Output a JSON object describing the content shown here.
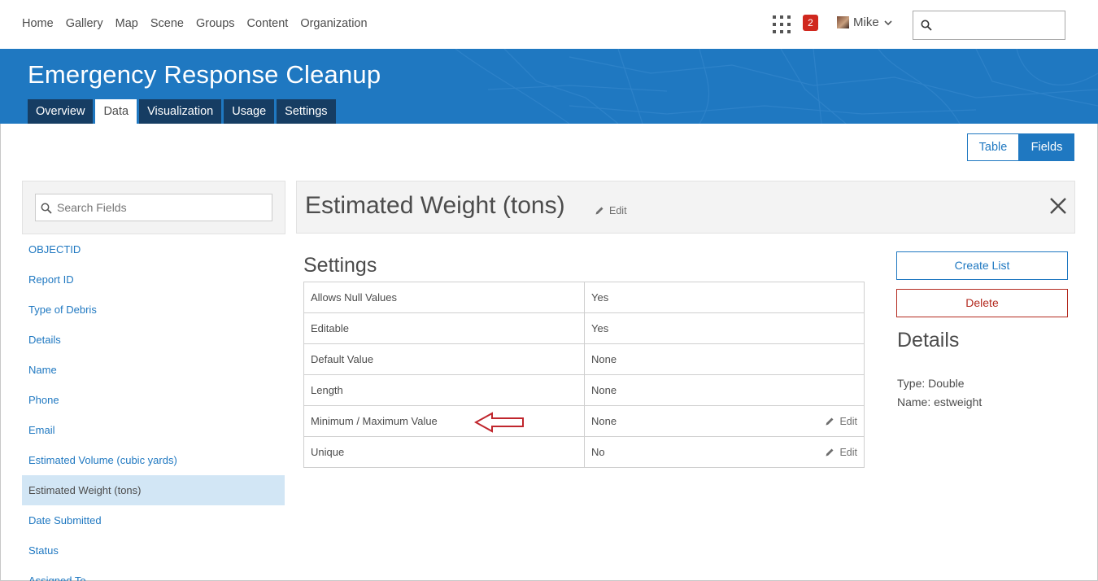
{
  "nav": {
    "links": [
      "Home",
      "Gallery",
      "Map",
      "Scene",
      "Groups",
      "Content",
      "Organization"
    ],
    "notification_count": "2",
    "user_name": "Mike",
    "search_placeholder": ""
  },
  "banner": {
    "title": "Emergency Response Cleanup",
    "tabs": [
      "Overview",
      "Data",
      "Visualization",
      "Usage",
      "Settings"
    ],
    "active_tab": "Data"
  },
  "view_toggle": {
    "table_label": "Table",
    "fields_label": "Fields",
    "active": "Fields"
  },
  "sidebar": {
    "search_placeholder": "Search Fields",
    "fields": [
      "OBJECTID",
      "Report ID",
      "Type of Debris",
      "Details",
      "Name",
      "Phone",
      "Email",
      "Estimated Volume (cubic yards)",
      "Estimated Weight (tons)",
      "Date Submitted",
      "Status",
      "Assigned To"
    ],
    "selected": "Estimated Weight (tons)"
  },
  "field": {
    "name": "Estimated Weight (tons)",
    "edit_label": "Edit"
  },
  "settings": {
    "title": "Settings",
    "rows": [
      {
        "label": "Allows Null Values",
        "value": "Yes",
        "edit": ""
      },
      {
        "label": "Editable",
        "value": "Yes",
        "edit": ""
      },
      {
        "label": "Default Value",
        "value": "None",
        "edit": ""
      },
      {
        "label": "Length",
        "value": "None",
        "edit": ""
      },
      {
        "label": "Minimum / Maximum Value",
        "value": "None",
        "edit": "Edit"
      },
      {
        "label": "Unique",
        "value": "No",
        "edit": "Edit"
      }
    ]
  },
  "actions": {
    "create_list": "Create List",
    "delete": "Delete"
  },
  "details": {
    "title": "Details",
    "type_line": "Type: Double",
    "name_line": "Name: estweight"
  },
  "colors": {
    "accent": "#1f78c1",
    "tab_dark": "#163d63",
    "danger": "#b32a1f",
    "badge": "#d0281e",
    "annotation_arrow": "#c0262d"
  }
}
